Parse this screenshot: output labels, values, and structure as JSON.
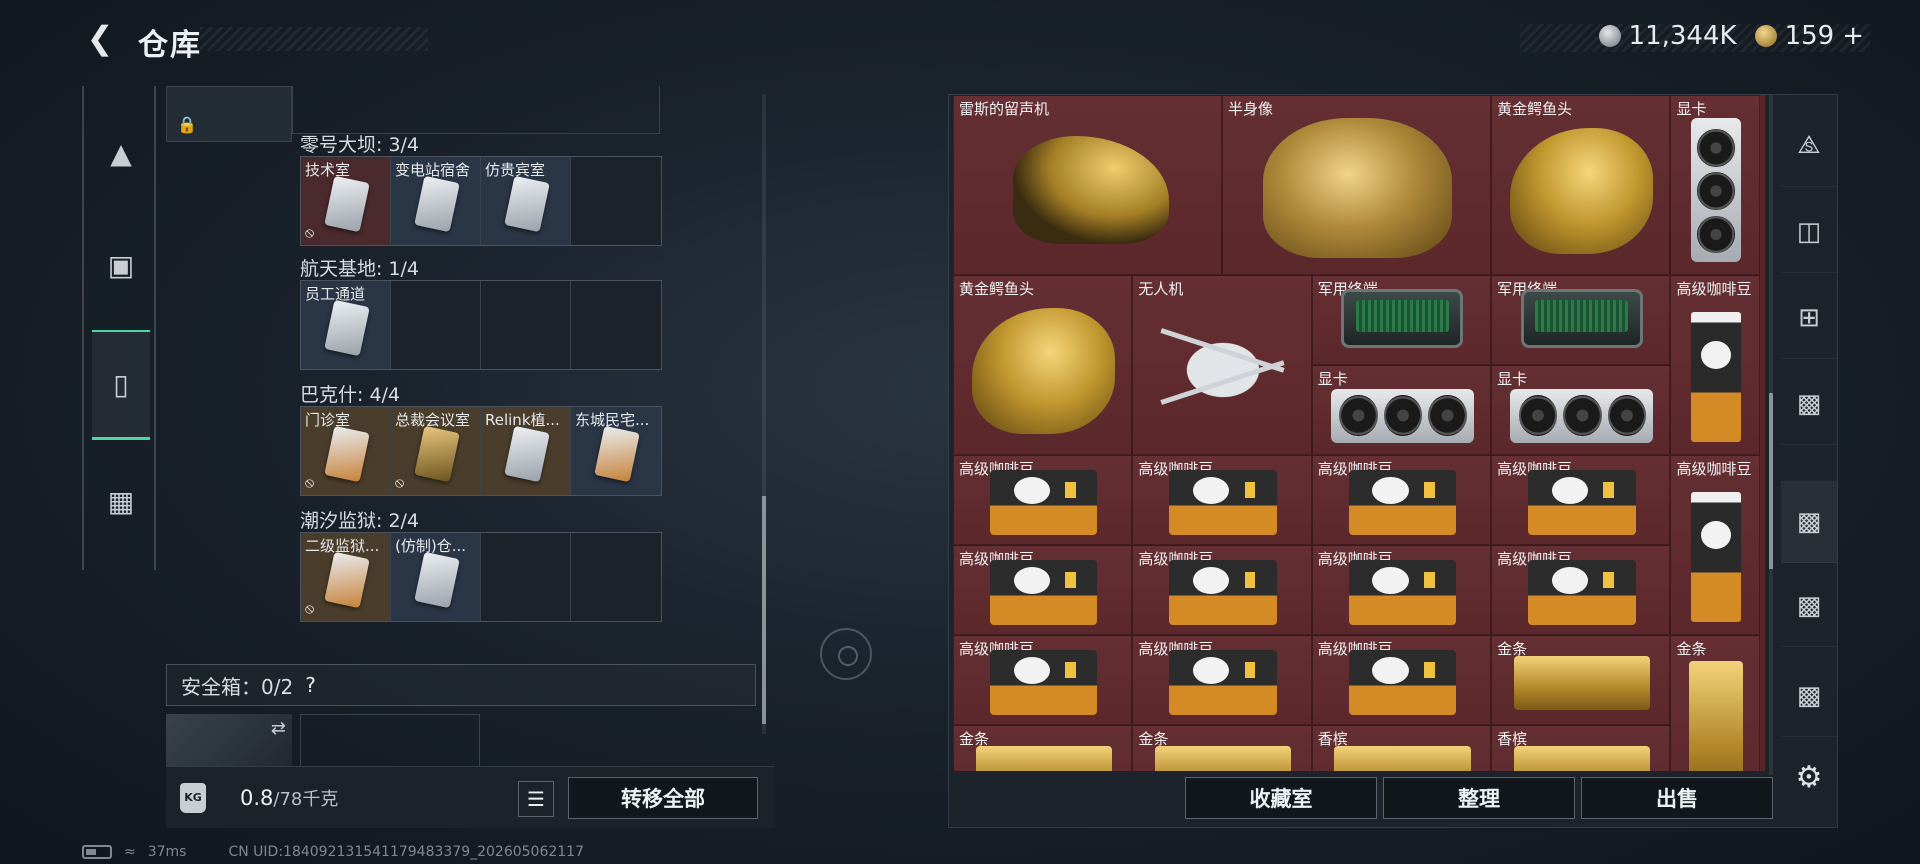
{
  "header": {
    "title": "仓库",
    "currency": [
      {
        "icon": "silver-coin-icon",
        "value": "11,344K"
      },
      {
        "icon": "gold-coin-icon",
        "value": "159"
      }
    ],
    "plus": "+"
  },
  "left_tabs": [
    {
      "icon": "pistol-icon",
      "active": false
    },
    {
      "icon": "backpack-icon",
      "active": false
    },
    {
      "icon": "vest-icon",
      "active": true
    },
    {
      "icon": "briefcase-icon",
      "active": false
    }
  ],
  "key_groups": [
    {
      "label": "零号大坝: 3/4",
      "keys": [
        {
          "name": "技术室",
          "color": "red",
          "card": "silver",
          "restricted": true
        },
        {
          "name": "变电站宿舍",
          "color": "blue",
          "card": "silver",
          "restricted": false
        },
        {
          "name": "仿贵宾室",
          "color": "blue",
          "card": "silver",
          "restricted": false
        },
        {
          "name": "",
          "color": "empty",
          "card": "",
          "restricted": false
        }
      ]
    },
    {
      "label": "航天基地: 1/4",
      "keys": [
        {
          "name": "员工通道",
          "color": "blue",
          "card": "silver",
          "restricted": false
        },
        {
          "name": "",
          "color": "empty",
          "card": "",
          "restricted": false
        },
        {
          "name": "",
          "color": "empty",
          "card": "",
          "restricted": false
        },
        {
          "name": "",
          "color": "empty",
          "card": "",
          "restricted": false
        }
      ]
    },
    {
      "label": "巴克什: 4/4",
      "keys": [
        {
          "name": "门诊室",
          "color": "gold",
          "card": "orange",
          "restricted": true
        },
        {
          "name": "总裁会议室",
          "color": "gold",
          "card": "gold",
          "restricted": true
        },
        {
          "name": "Relink植...",
          "color": "gold",
          "card": "silver",
          "restricted": false
        },
        {
          "name": "东城民宅...",
          "color": "blue",
          "card": "orange",
          "restricted": false
        }
      ]
    },
    {
      "label": "潮汐监狱: 2/4",
      "keys": [
        {
          "name": "二级监狱...",
          "color": "gold",
          "card": "orange",
          "restricted": true
        },
        {
          "name": "(仿制)仓...",
          "color": "blue",
          "card": "silver",
          "restricted": false
        },
        {
          "name": "",
          "color": "empty",
          "card": "",
          "restricted": false
        },
        {
          "name": "",
          "color": "empty",
          "card": "",
          "restricted": false
        }
      ]
    }
  ],
  "safe_box": {
    "label": "安全箱：0/2",
    "help": "?"
  },
  "bottom_left": {
    "weight_value": "0.8",
    "weight_max": "/78千克",
    "transfer_all": "转移全部"
  },
  "footer": {
    "ping": "37ms",
    "uid": "CN UID:184092131541179483379_202605062117"
  },
  "items": [
    {
      "name": "雷斯的留声机",
      "art": "gramophone"
    },
    {
      "name": "半身像",
      "art": "bust"
    },
    {
      "name": "黄金鳄鱼头",
      "art": "croc"
    },
    {
      "name": "显卡",
      "art": "gpu-vertical"
    },
    {
      "name": "黄金鳄鱼头",
      "art": "croc"
    },
    {
      "name": "无人机",
      "art": "drone"
    },
    {
      "name": "军用终端",
      "art": "terminal"
    },
    {
      "name": "军用终端",
      "art": "terminal"
    },
    {
      "name": "高级咖啡豆",
      "art": "coffee-tall"
    },
    {
      "name": "显卡",
      "art": "gpu"
    },
    {
      "name": "显卡",
      "art": "gpu"
    },
    {
      "name": "高级咖啡豆",
      "art": "coffee"
    },
    {
      "name": "高级咖啡豆",
      "art": "coffee"
    },
    {
      "name": "高级咖啡豆",
      "art": "coffee"
    },
    {
      "name": "高级咖啡豆",
      "art": "coffee"
    },
    {
      "name": "高级咖啡豆",
      "art": "coffee-tall"
    },
    {
      "name": "高级咖啡豆",
      "art": "coffee"
    },
    {
      "name": "高级咖啡豆",
      "art": "coffee"
    },
    {
      "name": "高级咖啡豆",
      "art": "coffee"
    },
    {
      "name": "高级咖啡豆",
      "art": "coffee"
    },
    {
      "name": "高级咖啡豆",
      "art": "coffee"
    },
    {
      "name": "高级咖啡豆",
      "art": "coffee"
    },
    {
      "name": "高级咖啡豆",
      "art": "coffee"
    },
    {
      "name": "金条",
      "art": "goldbar"
    },
    {
      "name": "金条",
      "art": "goldbar-vertical"
    },
    {
      "name": "金条",
      "art": "goldbar"
    },
    {
      "name": "金条",
      "art": "goldbar"
    },
    {
      "name": "香槟",
      "art": "goldbar"
    },
    {
      "name": "香槟",
      "art": "goldbar"
    }
  ],
  "right_tabs": [
    {
      "icon": "all-items-icon",
      "label": ""
    },
    {
      "icon": "storage-ii-icon",
      "label": ""
    },
    {
      "icon": "storage-ii-plus-icon",
      "label": ""
    },
    {
      "icon": "storage-iv-icon",
      "label": ""
    },
    {
      "icon": "storage-v-icon",
      "label": "",
      "active": true
    },
    {
      "icon": "storage-iv-b-icon",
      "label": ""
    },
    {
      "icon": "storage-iv-c-icon",
      "label": ""
    }
  ],
  "actions": {
    "collection": "收藏室",
    "organize": "整理",
    "sell": "出售"
  }
}
